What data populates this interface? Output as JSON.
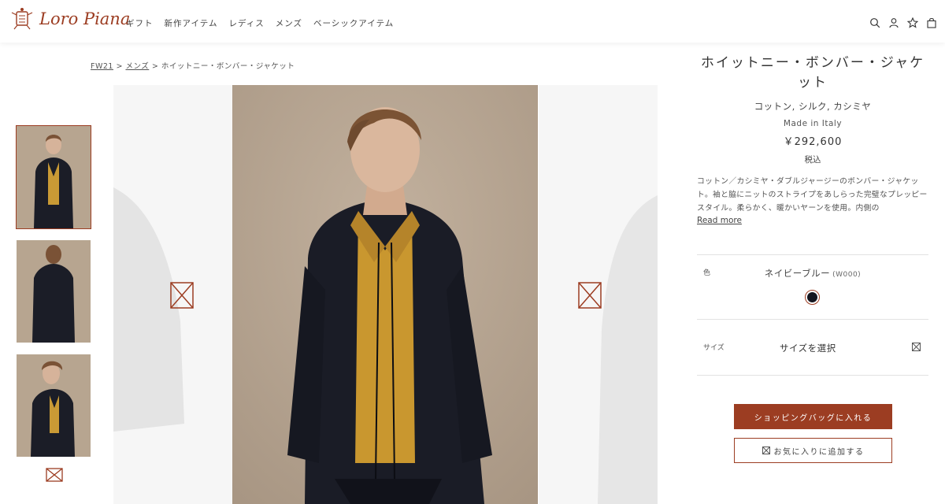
{
  "brand": {
    "name": "Loro Piana"
  },
  "nav": [
    "ギフト",
    "新作アイテム",
    "レディス",
    "メンズ",
    "ベーシックアイテム"
  ],
  "header_icons": [
    "search-icon",
    "account-icon",
    "wishlist-star-icon",
    "shopping-bag-icon"
  ],
  "breadcrumb": {
    "season": "FW21",
    "sep1": ">",
    "category": "メンズ",
    "sep2": ">",
    "current": "ホイットニー・ボンバー・ジャケット"
  },
  "product": {
    "title": "ホイットニー・ボンバー・ジャケット",
    "material": "コットン, シルク, カシミヤ",
    "origin": "Made in Italy",
    "price": "￥292,600",
    "tax": "税込",
    "description": "コットン／カシミヤ・ダブルジャージーのボンバー・ジャケット。袖と脇にニットのストライプをあしらった完璧なプレッピー スタイル。柔らかく、暖かいヤーンを使用。内側の",
    "read_more": "Read more"
  },
  "color": {
    "label": "色",
    "name": "ネイビーブルー",
    "code": "(W000)",
    "swatch": "#14161f"
  },
  "size": {
    "label": "サイズ",
    "placeholder": "サイズを選択"
  },
  "buttons": {
    "add_to_cart": "ショッピングバッグに入れる",
    "add_to_wishlist": "お気に入りに追加する"
  },
  "colors": {
    "accent": "#9c3d22",
    "background": "#ffffff",
    "photo_bg": "#b8a692"
  }
}
